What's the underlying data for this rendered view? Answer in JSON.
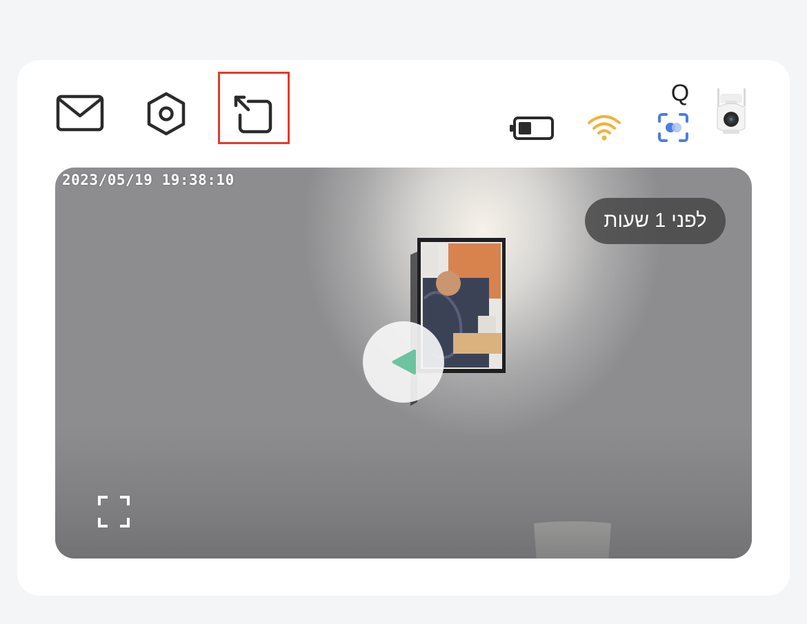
{
  "toolbar": {
    "icons": [
      "mail-icon",
      "settings-icon",
      "share-icon"
    ]
  },
  "device": {
    "name": "Q",
    "status_icons": [
      "battery-icon",
      "wifi-icon",
      "motion-detection-icon",
      "camera-icon"
    ],
    "wifi_color": "#f2b23a",
    "motion_color": "#4a7de6"
  },
  "video": {
    "timestamp": "2023/05/19  19:38:10",
    "last_update": "לפני 1 שעות",
    "play_color": "#6cc3a0"
  },
  "highlight_color": "#e63a2a"
}
